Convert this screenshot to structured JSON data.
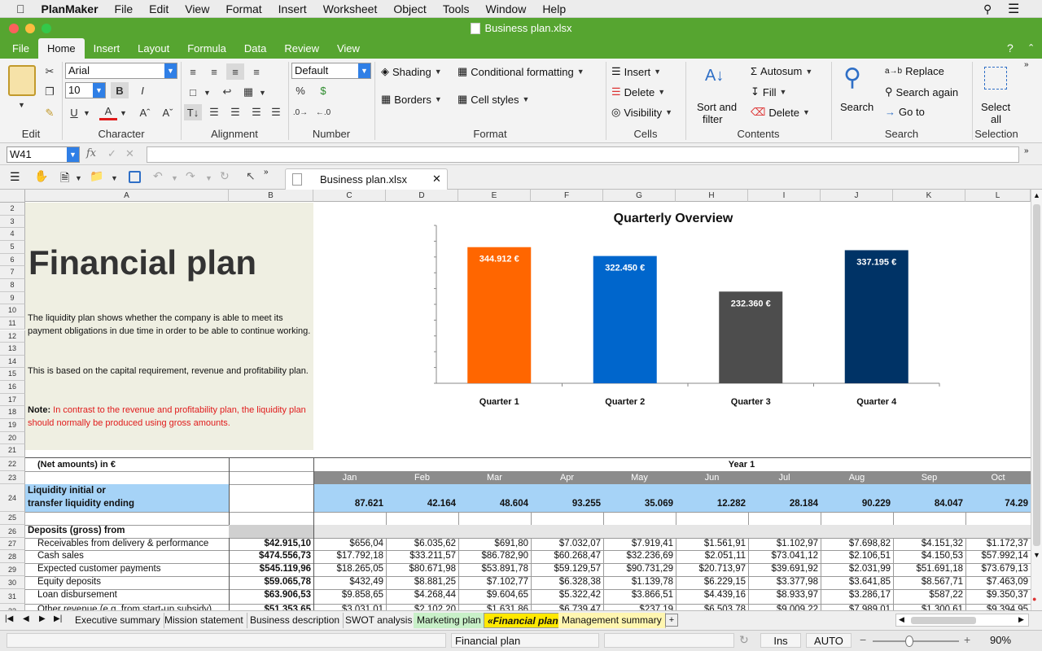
{
  "menubar": {
    "app": "PlanMaker",
    "items": [
      "File",
      "Edit",
      "View",
      "Format",
      "Insert",
      "Worksheet",
      "Object",
      "Tools",
      "Window",
      "Help"
    ]
  },
  "window": {
    "title": "Business plan.xlsx"
  },
  "ribbon_tabs": [
    "File",
    "Home",
    "Insert",
    "Layout",
    "Formula",
    "Data",
    "Review",
    "View"
  ],
  "ribbon": {
    "font_name": "Arial",
    "font_size": "10",
    "number_format": "Default",
    "shading": "Shading",
    "conditional_formatting": "Conditional formatting",
    "borders": "Borders",
    "cell_styles": "Cell styles",
    "insert": "Insert",
    "delete": "Delete",
    "visibility": "Visibility",
    "sort_filter_1": "Sort and",
    "sort_filter_2": "filter",
    "autosum": "Autosum",
    "fill": "Fill",
    "delete2": "Delete",
    "search": "Search",
    "replace": "Replace",
    "search_again": "Search again",
    "go_to": "Go to",
    "select_all_1": "Select",
    "select_all_2": "all",
    "bold": "B",
    "italic": "I",
    "underline": "U",
    "font_color": "A",
    "groups": [
      "Edit",
      "Character",
      "Alignment",
      "Number",
      "Format",
      "Cells",
      "Contents",
      "Search",
      "Selection"
    ]
  },
  "formula_bar": {
    "cell_ref": "W41",
    "fx": "fx",
    "value": ""
  },
  "doc_tab": "Business plan.xlsx",
  "columns": [
    "A",
    "B",
    "C",
    "D",
    "E",
    "F",
    "G",
    "H",
    "I",
    "J",
    "K",
    "L"
  ],
  "rows": [
    "2",
    "3",
    "4",
    "5",
    "6",
    "7",
    "8",
    "9",
    "10",
    "11",
    "12",
    "13",
    "14",
    "15",
    "16",
    "17",
    "18",
    "19",
    "20",
    "21",
    "22",
    "23",
    "24",
    "25",
    "26",
    "27",
    "28",
    "29",
    "30",
    "31",
    "32"
  ],
  "intro": {
    "title": "Financial plan",
    "p1": "The liquidity plan shows whether the company is able to meet its payment obligations in due time in order to be able to continue working.",
    "p2": "This is based on the capital requirement, revenue and profitability plan.",
    "note_label": "Note:",
    "note_text": " In contrast to the revenue and profitability plan, the liquidity plan should normally be produced using gross amounts."
  },
  "chart_data": {
    "type": "bar",
    "title": "Quarterly Overview",
    "categories": [
      "Quarter 1",
      "Quarter 2",
      "Quarter 3",
      "Quarter 4"
    ],
    "values": [
      344912,
      322450,
      232360,
      337195
    ],
    "labels": [
      "344.912 €",
      "322.450 €",
      "232.360 €",
      "337.195 €"
    ],
    "colors": [
      "#ff6600",
      "#0066cc",
      "#4d4d4d",
      "#003366"
    ],
    "ylim": [
      0,
      400000
    ],
    "grid": false,
    "legend": "none"
  },
  "table": {
    "net_amounts": "(Net amounts) in €",
    "year": "Year 1",
    "months": [
      "Jan",
      "Feb",
      "Mar",
      "Apr",
      "May",
      "Jun",
      "Jul",
      "Aug",
      "Sep",
      "Oct"
    ],
    "liquidity_label_1": "Liquidity initial or",
    "liquidity_label_2": "transfer liquidity ending",
    "liquidity_values": [
      "87.621",
      "42.164",
      "48.604",
      "93.255",
      "35.069",
      "12.282",
      "28.184",
      "90.229",
      "84.047",
      "74.29"
    ],
    "deposits_label": "Deposits (gross) from",
    "rows": [
      {
        "label": "Receivables from delivery & performance",
        "total": "$42.915,10",
        "values": [
          "$656,04",
          "$6.035,62",
          "$691,80",
          "$7.032,07",
          "$7.919,41",
          "$1.561,91",
          "$1.102,97",
          "$7.698,82",
          "$4.151,32",
          "$1.172,37"
        ]
      },
      {
        "label": "Cash sales",
        "total": "$474.556,73",
        "values": [
          "$17.792,18",
          "$33.211,57",
          "$86.782,90",
          "$60.268,47",
          "$32.236,69",
          "$2.051,11",
          "$73.041,12",
          "$2.106,51",
          "$4.150,53",
          "$57.992,14"
        ]
      },
      {
        "label": "Expected customer payments",
        "total": "$545.119,96",
        "values": [
          "$18.265,05",
          "$80.671,98",
          "$53.891,78",
          "$59.129,57",
          "$90.731,29",
          "$20.713,97",
          "$39.691,92",
          "$2.031,99",
          "$51.691,18",
          "$73.679,13"
        ]
      },
      {
        "label": "Equity deposits",
        "total": "$59.065,78",
        "values": [
          "$432,49",
          "$8.881,25",
          "$7.102,77",
          "$6.328,38",
          "$1.139,78",
          "$6.229,15",
          "$3.377,98",
          "$3.641,85",
          "$8.567,71",
          "$7.463,09"
        ]
      },
      {
        "label": "Loan disbursement",
        "total": "$63.906,53",
        "values": [
          "$9.858,65",
          "$4.268,44",
          "$9.604,65",
          "$5.322,42",
          "$3.866,51",
          "$4.439,16",
          "$8.933,97",
          "$3.286,17",
          "$587,22",
          "$9.350,37"
        ]
      },
      {
        "label": "Other revenue (e.g. from start-up subsidy)",
        "total": "$51.353,65",
        "values": [
          "$3.031,01",
          "$2.102,20",
          "$1.631,86",
          "$6.739,47",
          "$237,19",
          "$6.503,78",
          "$9.009,22",
          "$7.989,01",
          "$1.300,61",
          "$9.394,95"
        ]
      }
    ]
  },
  "sheet_tabs": [
    "Executive summary",
    "Mission statement",
    "Business description",
    "SWOT analysis",
    "Marketing plan",
    "«Financial plan»",
    "Management summary"
  ],
  "status": {
    "sheet": "Financial plan",
    "ins": "Ins",
    "auto": "AUTO",
    "zoom": "90%",
    "minus": "−",
    "plus": "+"
  }
}
